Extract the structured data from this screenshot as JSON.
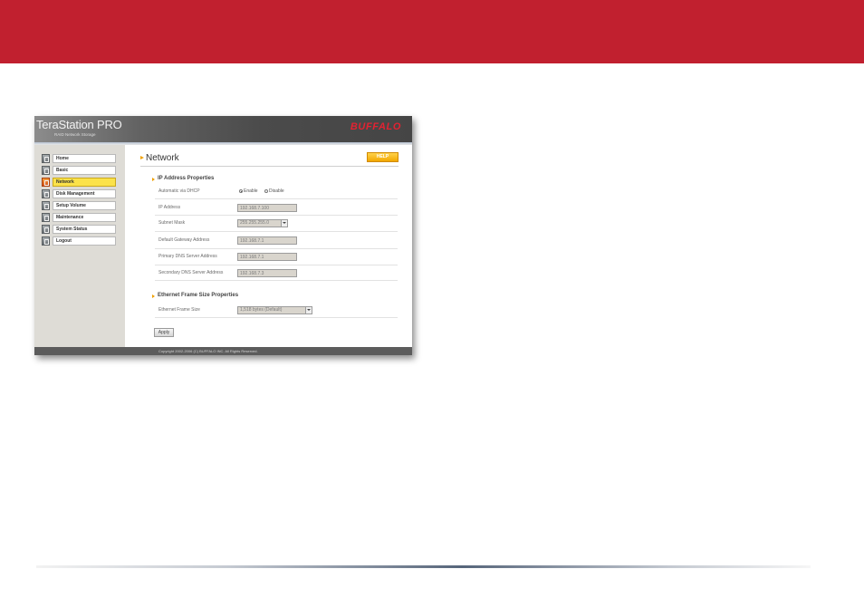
{
  "colors": {
    "banner": "#c1202f",
    "logo": "#e32232",
    "active_nav": "#fbe24a",
    "help_button": "#f2a800"
  },
  "app": {
    "brand": "TeraStation PRO",
    "tagline": "RAID Network Storage",
    "logo": "BUFFALO"
  },
  "sidebar": {
    "items": [
      {
        "label": "Home",
        "icon": "home-icon"
      },
      {
        "label": "Basic",
        "icon": "basic-icon"
      },
      {
        "label": "Network",
        "icon": "network-icon",
        "active": true
      },
      {
        "label": "Disk Management",
        "icon": "disk-icon"
      },
      {
        "label": "Setup Volume",
        "icon": "volume-icon"
      },
      {
        "label": "Maintenance",
        "icon": "maintenance-icon"
      },
      {
        "label": "System Status",
        "icon": "status-icon"
      },
      {
        "label": "Logout",
        "icon": "logout-icon"
      }
    ]
  },
  "main": {
    "title": "Network",
    "help_label": "HELP",
    "ip_section": {
      "heading": "IP Address Properties",
      "dhcp": {
        "label": "Automatic via DHCP",
        "enable_label": "Enable",
        "disable_label": "Disable",
        "selected": "Enable"
      },
      "ip_address": {
        "label": "IP Address",
        "value": "192.168.7.100"
      },
      "subnet_mask": {
        "label": "Subnet Mask",
        "value": "255.255.255.0"
      },
      "gateway": {
        "label": "Default Gateway Address",
        "value": "192.168.7.1"
      },
      "primary_dns": {
        "label": "Primary DNS Server Address",
        "value": "192.168.7.1"
      },
      "secondary_dns": {
        "label": "Secondary DNS Server Address",
        "value": "192.168.7.3"
      }
    },
    "frame_section": {
      "heading": "Ethernet Frame Size Properties",
      "frame_size": {
        "label": "Ethernet Frame Size",
        "value": "1,518 bytes (Default)"
      }
    },
    "apply_label": "Apply"
  },
  "footer": {
    "copyright": "Copyright 2002-2006 (C) BUFFALO INC. All Rights Reserved."
  }
}
